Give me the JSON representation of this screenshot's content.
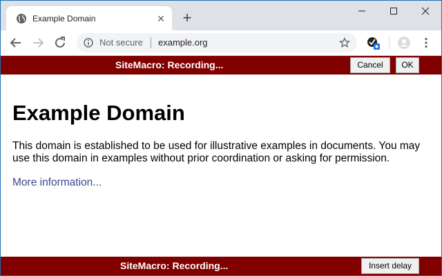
{
  "browser": {
    "tab": {
      "title": "Example Domain",
      "favicon": "globe-icon",
      "close_glyph": "✕"
    },
    "new_tab_glyph": "+",
    "window_controls": {
      "minimize": "—",
      "maximize": "☐",
      "close": "✕"
    },
    "omnibox": {
      "security_label": "Not secure",
      "url": "example.org"
    }
  },
  "recorder": {
    "top_bar": {
      "status": "SiteMacro: Recording...",
      "cancel_label": "Cancel",
      "ok_label": "OK"
    },
    "bottom_bar": {
      "status": "SiteMacro: Recording...",
      "insert_delay_label": "Insert delay"
    },
    "bar_color": "#800000"
  },
  "page": {
    "heading": "Example Domain",
    "paragraph": "This domain is established to be used for illustrative examples in documents. You may use this domain in examples without prior coordination or asking for permission.",
    "link_text": "More information...",
    "link_color": "#38488f"
  }
}
